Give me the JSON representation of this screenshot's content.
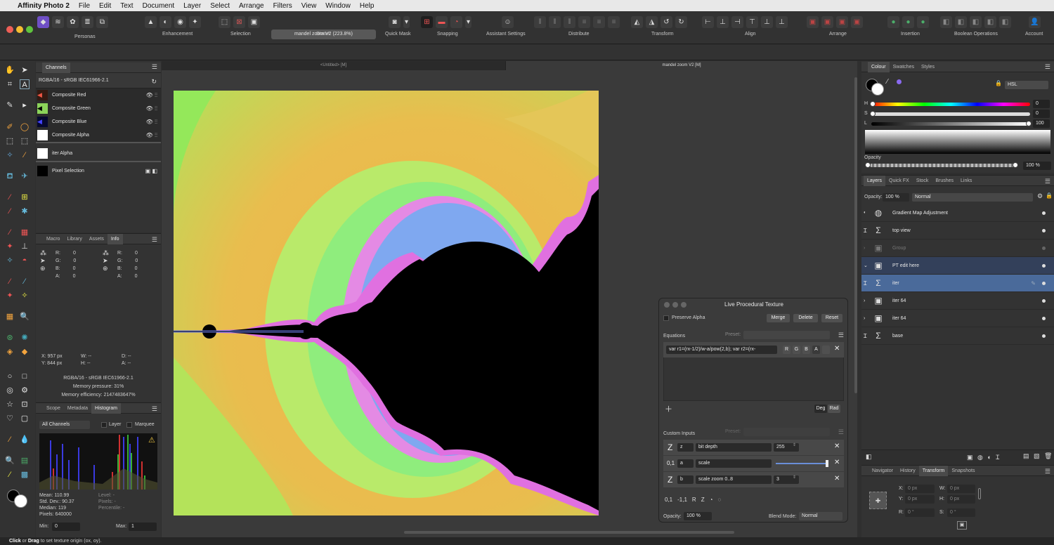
{
  "menubar": {
    "app": "Affinity Photo 2",
    "items": [
      "File",
      "Edit",
      "Text",
      "Document",
      "Layer",
      "Select",
      "Arrange",
      "Filters",
      "View",
      "Window",
      "Help"
    ]
  },
  "toolbar": {
    "groups": [
      "Personas",
      "Enhancement",
      "Selection",
      "Status",
      "Quick Mask",
      "Snapping",
      "Assistant Settings",
      "Distribute",
      "Transform",
      "Align",
      "Arrange",
      "Insertion",
      "Boolean Operations",
      "Account"
    ],
    "status_text": "mandel zoom V2 (223.8%)"
  },
  "doc_tabs": [
    "<Untitled> [M]",
    "mandel zoom V2 [M]"
  ],
  "channels": {
    "tab": "Channels",
    "profile": "RGBA/16 - sRGB IEC61966-2.1",
    "rows": [
      "Composite Red",
      "Composite Green",
      "Composite Blue",
      "Composite Alpha",
      "iter Alpha",
      "Pixel Selection"
    ]
  },
  "info": {
    "tabs": [
      "Macro",
      "Library",
      "Assets",
      "Info"
    ],
    "labels": [
      "R:",
      "G:",
      "B:",
      "A:"
    ],
    "values": [
      "0",
      "0",
      "0",
      "0"
    ],
    "x": "X: 957 px",
    "y": "Y: 844 px",
    "w": "W: --",
    "h": "H: --",
    "d": "D: --",
    "a": "A: --",
    "profile": "RGBA/16 - sRGB IEC61966-2.1",
    "mem_pressure": "Memory pressure: 31%",
    "mem_eff": "Memory efficiency: 2147483647%"
  },
  "histogram": {
    "tabs": [
      "Scope",
      "Metadata",
      "Histogram"
    ],
    "channel_select": "All Channels",
    "layer_label": "Layer",
    "marquee_label": "Marquee",
    "mean": "Mean: 110.99",
    "std": "Std. Dev.: 90.37",
    "median": "Median: 119",
    "pixels": "Pixels: 640000",
    "level": "Level: -",
    "pixels2": "Pixels: -",
    "percentile": "Percentile: -",
    "min_label": "Min:",
    "min_val": "0",
    "max_label": "Max:",
    "max_val": "1"
  },
  "colour": {
    "tabs": [
      "Colour",
      "Swatches",
      "Styles"
    ],
    "model": "HSL",
    "h": "0",
    "s": "0",
    "l": "100",
    "h_label": "H",
    "s_label": "S",
    "l_label": "L",
    "opacity_label": "Opacity",
    "opacity": "100 %"
  },
  "layers": {
    "tabs": [
      "Layers",
      "Quick FX",
      "Stock",
      "Brushes",
      "Links"
    ],
    "opacity_label": "Opacity:",
    "opacity": "100 %",
    "blend": "Normal",
    "items": [
      "Gradient Map Adjustment",
      "top view",
      "Group",
      "PT edit here",
      "iter",
      "iter 64",
      "iter 64",
      "base"
    ]
  },
  "transform": {
    "tabs": [
      "Navigator",
      "History",
      "Transform",
      "Snapshots"
    ],
    "x": "X:",
    "x_val": "0 px",
    "y": "Y:",
    "y_val": "0 px",
    "w": "W:",
    "w_val": "0 px",
    "h": "H:",
    "h_val": "0 px",
    "r": "R:",
    "r_val": "0 °",
    "s": "S:",
    "s_val": "0 °"
  },
  "dialog": {
    "title": "Live Procedural Texture",
    "preserve_alpha": "Preserve Alpha",
    "merge": "Merge",
    "delete": "Delete",
    "reset": "Reset",
    "equations_label": "Equations",
    "preset_label": "Preset:",
    "equation": "var r1=(rx-1/2)/w-a/pow(2,b); var r2=(rx-",
    "channels": [
      "R",
      "G",
      "B",
      "A"
    ],
    "deg": "Deg",
    "rad": "Rad",
    "custom_inputs": "Custom Inputs",
    "inputs": [
      {
        "type": "Z",
        "name": "z",
        "label": "bit depth",
        "value": "255"
      },
      {
        "type": "0,1",
        "name": "a",
        "label": "scale",
        "value": ""
      },
      {
        "type": "Z",
        "name": "b",
        "label": "scale zoom 0..8",
        "value": "3"
      }
    ],
    "bottom_types": [
      "0,1",
      "-1,1",
      "R",
      "Z"
    ],
    "opacity_label": "Opacity:",
    "opacity": "100 %",
    "blend_label": "Blend Mode:",
    "blend": "Normal"
  },
  "statusbar": {
    "click": "Click",
    "or": " or ",
    "drag": "Drag",
    "rest": " to set texture origin (ox, oy)."
  }
}
